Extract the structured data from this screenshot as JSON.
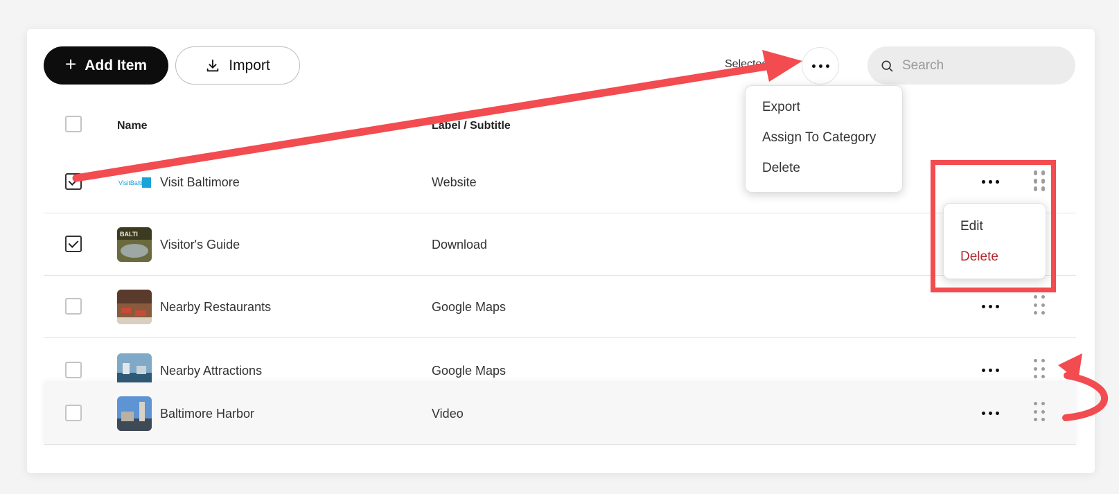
{
  "toolbar": {
    "add_label": "Add Item",
    "import_label": "Import",
    "selected_label": "Selected",
    "search_placeholder": "Search"
  },
  "table": {
    "columns": [
      "Name",
      "Label / Subtitle"
    ],
    "rows": [
      {
        "name": "Visit Baltimore",
        "label": "Website",
        "checked": true
      },
      {
        "name": "Visitor's Guide",
        "label": "Download",
        "checked": true
      },
      {
        "name": "Nearby Restaurants",
        "label": "Google Maps",
        "checked": false
      },
      {
        "name": "Nearby Attractions",
        "label": "Google Maps",
        "checked": false
      },
      {
        "name": "Baltimore Harbor",
        "label": "Video",
        "checked": false
      }
    ]
  },
  "bulk_menu": {
    "items": [
      "Export",
      "Assign To Category",
      "Delete"
    ]
  },
  "row_menu": {
    "items": [
      "Edit",
      "Delete"
    ]
  },
  "colors": {
    "annotation_red": "#f24b50",
    "primary_button": "#0d0d0d",
    "danger_text": "#b3262e"
  },
  "icons": {
    "add": "plus-icon",
    "import": "download-icon",
    "search": "search-icon",
    "more": "more-horizontal-icon",
    "drag": "drag-handle-icon",
    "check": "checkmark-icon"
  }
}
